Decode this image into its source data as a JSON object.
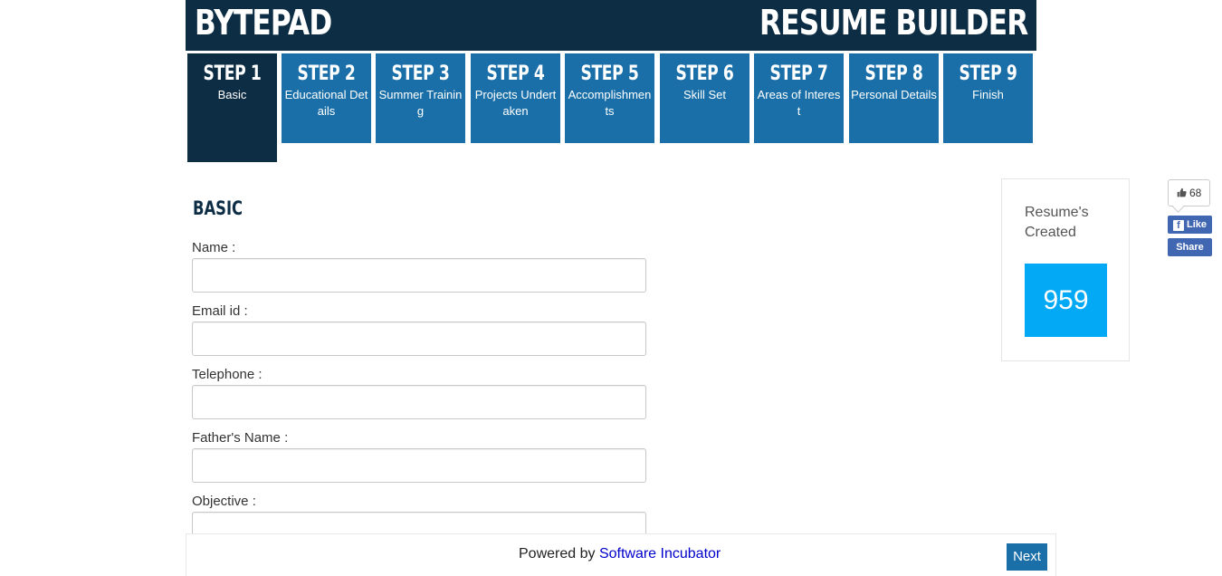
{
  "header": {
    "brand": "BYTEPAD",
    "title": "RESUME BUILDER"
  },
  "steps": [
    {
      "num": "STEP 1",
      "label": "Basic"
    },
    {
      "num": "STEP 2",
      "label": "Educational Details"
    },
    {
      "num": "STEP 3",
      "label": "Summer Training"
    },
    {
      "num": "STEP 4",
      "label": "Projects Undertaken"
    },
    {
      "num": "STEP 5",
      "label": "Accomplishments"
    },
    {
      "num": "STEP 6",
      "label": "Skill Set"
    },
    {
      "num": "STEP 7",
      "label": "Areas of Interest"
    },
    {
      "num": "STEP 8",
      "label": "Personal Details"
    },
    {
      "num": "STEP 9",
      "label": "Finish"
    }
  ],
  "active_step": 1,
  "section": {
    "title": "BASIC"
  },
  "form": {
    "name_label": "Name :",
    "name_value": "",
    "email_label": "Email id :",
    "email_value": "",
    "telephone_label": "Telephone :",
    "telephone_value": "",
    "father_label": "Father's Name :",
    "father_value": "",
    "objective_label": "Objective :",
    "objective_value": ""
  },
  "stats": {
    "title": "Resume's Created",
    "count": "959"
  },
  "facebook": {
    "count": "68",
    "like_label": "Like",
    "share_label": "Share"
  },
  "footer": {
    "powered_prefix": "Powered by ",
    "powered_link": "Software Incubator",
    "next_label": "Next"
  },
  "colors": {
    "header_bg": "#0d2d45",
    "step_bg": "#1a6fa8",
    "counter_bg": "#03a9f4",
    "facebook": "#4267b2"
  }
}
